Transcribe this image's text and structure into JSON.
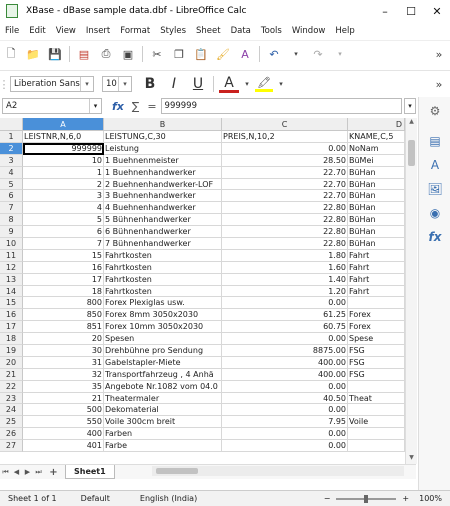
{
  "window": {
    "title": "XBase - dBase sample data.dbf - LibreOffice Calc",
    "minimize": "–",
    "maximize": "☐",
    "close": "✕"
  },
  "menu": [
    "File",
    "Edit",
    "View",
    "Insert",
    "Format",
    "Styles",
    "Sheet",
    "Data",
    "Tools",
    "Window",
    "Help"
  ],
  "format_bar": {
    "font_name": "Liberation Sans",
    "font_size": "10",
    "bold": "B",
    "italic": "I",
    "underline": "U",
    "font_color": "A"
  },
  "formula_bar": {
    "cell_ref": "A2",
    "content": "999999",
    "fx": "fx",
    "sigma": "∑",
    "equals": "="
  },
  "columns": [
    "A",
    "B",
    "C",
    "D"
  ],
  "header_row": [
    "LEISTNR,N,6,0",
    "LEISTUNG,C,30",
    "PREIS,N,10,2",
    "KNAME,C,5"
  ],
  "rows": [
    {
      "n": "2",
      "a": "999999",
      "b": "Leistung",
      "c": "0.00",
      "d": "NoNam"
    },
    {
      "n": "3",
      "a": "10",
      "b": "1 Buehnenmeister",
      "c": "28.50",
      "d": "BüMei"
    },
    {
      "n": "4",
      "a": "1",
      "b": "1 Buehnenhandwerker",
      "c": "22.70",
      "d": "BüHan"
    },
    {
      "n": "5",
      "a": "2",
      "b": "2 Buehnenhandwerker-LOF",
      "c": "22.70",
      "d": "BüHan"
    },
    {
      "n": "6",
      "a": "3",
      "b": "3 Buehnenhandwerker",
      "c": "22.70",
      "d": "BüHan"
    },
    {
      "n": "7",
      "a": "4",
      "b": "4 Buehnenhandwerker",
      "c": "22.80",
      "d": "BüHan"
    },
    {
      "n": "8",
      "a": "5",
      "b": "5 Bühnenhandwerker",
      "c": "22.80",
      "d": "BüHan"
    },
    {
      "n": "9",
      "a": "6",
      "b": "6 Bühnenhandwerker",
      "c": "22.80",
      "d": "BüHan"
    },
    {
      "n": "10",
      "a": "7",
      "b": "7 Bühnenhandwerker",
      "c": "22.80",
      "d": "BüHan"
    },
    {
      "n": "11",
      "a": "15",
      "b": "Fahrtkosten",
      "c": "1.80",
      "d": "Fahrt"
    },
    {
      "n": "12",
      "a": "16",
      "b": "Fahrtkosten",
      "c": "1.60",
      "d": "Fahrt"
    },
    {
      "n": "13",
      "a": "17",
      "b": "Fahrtkosten",
      "c": "1.40",
      "d": "Fahrt"
    },
    {
      "n": "14",
      "a": "18",
      "b": "Fahrtkosten",
      "c": "1.20",
      "d": "Fahrt"
    },
    {
      "n": "15",
      "a": "800",
      "b": "Forex Plexiglas usw.",
      "c": "0.00",
      "d": ""
    },
    {
      "n": "16",
      "a": "850",
      "b": "Forex 8mm 3050x2030",
      "c": "61.25",
      "d": "Forex"
    },
    {
      "n": "17",
      "a": "851",
      "b": "Forex 10mm 3050x2030",
      "c": "60.75",
      "d": "Forex"
    },
    {
      "n": "18",
      "a": "20",
      "b": "Spesen",
      "c": "0.00",
      "d": "Spese"
    },
    {
      "n": "19",
      "a": "30",
      "b": "Drehbühne pro Sendung",
      "c": "8875.00",
      "d": "FSG"
    },
    {
      "n": "20",
      "a": "31",
      "b": "Gabelstapler-Miete",
      "c": "400.00",
      "d": "FSG"
    },
    {
      "n": "21",
      "a": "32",
      "b": "Transportfahrzeug , 4 Anhä",
      "c": "400.00",
      "d": "FSG"
    },
    {
      "n": "22",
      "a": "35",
      "b": "Angebote Nr.1082 vom 04.0",
      "c": "0.00",
      "d": ""
    },
    {
      "n": "23",
      "a": "21",
      "b": "Theatermaler",
      "c": "40.50",
      "d": "Theat"
    },
    {
      "n": "24",
      "a": "500",
      "b": "Dekomaterial",
      "c": "0.00",
      "d": ""
    },
    {
      "n": "25",
      "a": "550",
      "b": "Voile 300cm breit",
      "c": "7.95",
      "d": "Voile"
    },
    {
      "n": "26",
      "a": "400",
      "b": "Farben",
      "c": "0.00",
      "d": ""
    },
    {
      "n": "27",
      "a": "401",
      "b": "Farbe",
      "c": "0.00",
      "d": ""
    }
  ],
  "sheet_tab": "Sheet1",
  "statusbar": {
    "sheet": "Sheet 1 of 1",
    "style": "Default",
    "language": "English (India)",
    "zoom": "100%"
  }
}
